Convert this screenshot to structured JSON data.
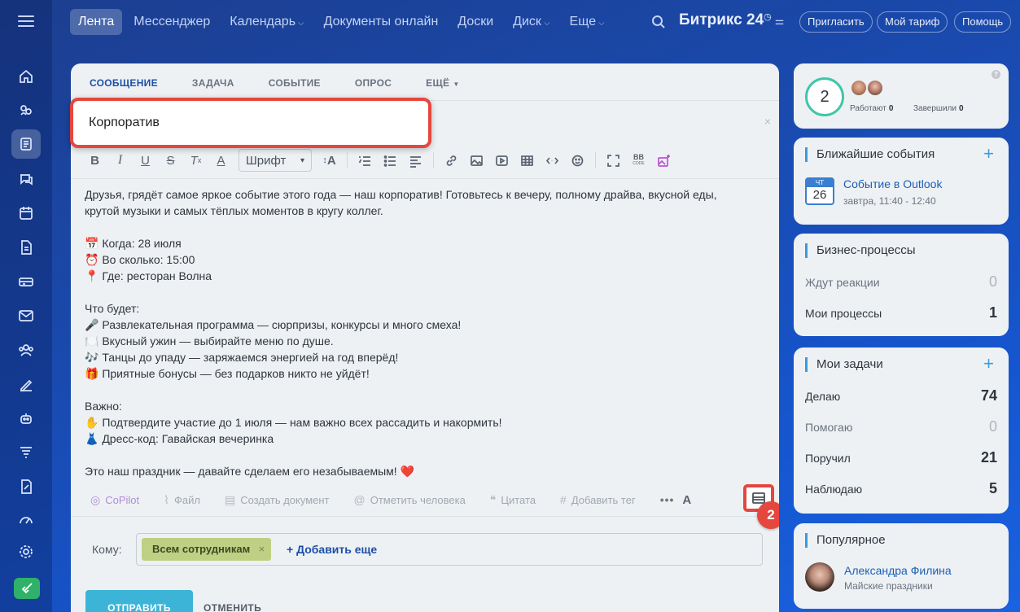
{
  "topnav": {
    "items": [
      {
        "label": "Лента",
        "active": true
      },
      {
        "label": "Мессенджер"
      },
      {
        "label": "Календарь",
        "dropdown": true
      },
      {
        "label": "Документы онлайн"
      },
      {
        "label": "Доски"
      },
      {
        "label": "Диск",
        "dropdown": true
      },
      {
        "label": "Еще",
        "dropdown": true
      }
    ],
    "brand": "Битрикс 24",
    "invite": "Пригласить",
    "tariff": "Мой тариф",
    "help": "Помощь"
  },
  "composer": {
    "tabs": [
      "СООБЩЕНИЕ",
      "ЗАДАЧА",
      "СОБЫТИЕ",
      "ОПРОС",
      "ЕЩЁ"
    ],
    "title_value": "Корпоратив",
    "font_label": "Шрифт",
    "body": "Друзья, грядёт самое яркое событие этого года — наш корпоратив! Готовьтесь к вечеру, полному драйва, вкусной еды,\nкрутой музыки и самых тёплых моментов в кругу коллег.\n\n📅 Когда: 28 июля\n⏰ Во сколько: 15:00\n📍 Где: ресторан Волна\n\nЧто будет:\n🎤 Развлекательная программа — сюрпризы, конкурсы и много смеха!\n🍽️ Вкусный ужин — выбирайте меню по душе.\n🎶 Танцы до упаду — заряжаемся энергией на год вперёд!\n🎁 Приятные бонусы — без подарков никто не уйдёт!\n\nВажно:\n✋ Подтвердите участие до 1 июля — нам важно всех рассадить и накормить!\n👗 Дресс-код: Гавайская вечеринка\n\nЭто наш праздник — давайте сделаем его незабываемым! ❤️",
    "actions": {
      "copilot": "CoPilot",
      "file": "Файл",
      "create_doc": "Создать документ",
      "mention": "Отметить человека",
      "quote": "Цитата",
      "tag": "Добавить тег"
    },
    "step_badge": "2",
    "to_label": "Кому:",
    "recipient": "Всем сотрудникам",
    "add_more": "+ Добавить еще",
    "send": "ОТПРАВИТЬ",
    "cancel": "ОТМЕНИТЬ"
  },
  "sidebar": {
    "workload": {
      "count": "2",
      "working_label": "Работают",
      "working_value": "0",
      "done_label": "Завершили",
      "done_value": "0"
    },
    "events": {
      "title": "Ближайшие события",
      "day_short": "ЧТ",
      "day_num": "26",
      "event_title": "Событие в Outlook",
      "event_time": "завтра, 11:40 - 12:40"
    },
    "bp": {
      "title": "Бизнес-процессы",
      "rows": [
        {
          "label": "Ждут реакции",
          "value": "0"
        },
        {
          "label": "Мои процессы",
          "value": "1"
        }
      ]
    },
    "tasks": {
      "title": "Мои задачи",
      "rows": [
        {
          "label": "Делаю",
          "value": "74"
        },
        {
          "label": "Помогаю",
          "value": "0"
        },
        {
          "label": "Поручил",
          "value": "21"
        },
        {
          "label": "Наблюдаю",
          "value": "5"
        }
      ]
    },
    "popular": {
      "title": "Популярное",
      "name": "Александра Филина",
      "subtitle": "Майские праздники"
    }
  },
  "colors": {
    "accent": "#1c4fa6",
    "highlight": "#e5473f",
    "chip": "#bfd085",
    "send": "#3cb4d8"
  }
}
